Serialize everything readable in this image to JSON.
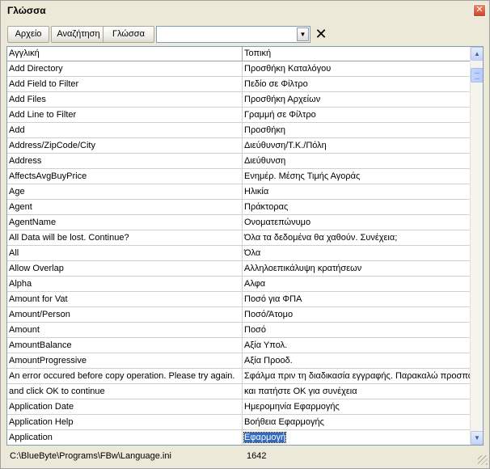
{
  "window": {
    "title": "Γλώσσα"
  },
  "toolbar": {
    "file_label": "Αρχείο",
    "search_label": "Αναζήτηση",
    "language_label": "Γλώσσα",
    "search_value": "",
    "clear_symbol": "✕"
  },
  "grid": {
    "columns": [
      "Αγγλική",
      "Τοπική"
    ],
    "rows": [
      {
        "english": "Add Directory",
        "local": "Προσθήκη Καταλόγου"
      },
      {
        "english": "Add Field to Filter",
        "local": "Πεδίο σε Φίλτρο"
      },
      {
        "english": "Add Files",
        "local": "Προσθήκη Αρχείων"
      },
      {
        "english": "Add Line to Filter",
        "local": "Γραμμή σε Φίλτρο"
      },
      {
        "english": "Add",
        "local": "Προσθήκη"
      },
      {
        "english": "Address/ZipCode/City",
        "local": "Διεύθυνση/Τ.Κ./Πόλη"
      },
      {
        "english": "Address",
        "local": "Διεύθυνση"
      },
      {
        "english": "AffectsAvgBuyPrice",
        "local": "Ενημέρ. Μέσης Τιμής Αγοράς"
      },
      {
        "english": "Age",
        "local": "Ηλικία"
      },
      {
        "english": "Agent",
        "local": "Πράκτορας"
      },
      {
        "english": "AgentName",
        "local": "Ονοματεπώνυμο"
      },
      {
        "english": "All Data will be lost. Continue?",
        "local": "Όλα τα δεδομένα θα χαθούν. Συνέχεια;"
      },
      {
        "english": "All",
        "local": "Όλα"
      },
      {
        "english": "Allow Overlap",
        "local": "Αλληλοεπικάλυψη κρατήσεων"
      },
      {
        "english": "Alpha",
        "local": "Αλφα"
      },
      {
        "english": "Amount for Vat",
        "local": "Ποσό για ΦΠΑ"
      },
      {
        "english": "Amount/Person",
        "local": "Ποσό/Άτομο"
      },
      {
        "english": "Amount",
        "local": "Ποσό"
      },
      {
        "english": "AmountBalance",
        "local": "Αξία Υπολ."
      },
      {
        "english": "AmountProgressive",
        "local": "Αξία Προοδ."
      },
      {
        "english": "An error occured before copy operation. Please try again.",
        "local": "Σφάλμα πριν τη διαδικασία εγγραφής. Παρακαλώ προσπαθ"
      },
      {
        "english": "and click OK to continue",
        "local": "και πατήστε OK για συνέχεια"
      },
      {
        "english": "Application Date",
        "local": "Ημερομηνία Εφαρμογής"
      },
      {
        "english": "Application Help",
        "local": "Βοήθεια Εφαρμογής"
      },
      {
        "english": "Application",
        "local": "Εφαρμογή"
      }
    ]
  },
  "status": {
    "path": "C:\\BlueByte\\Programs\\FBw\\Language.ini",
    "count": "1642"
  }
}
